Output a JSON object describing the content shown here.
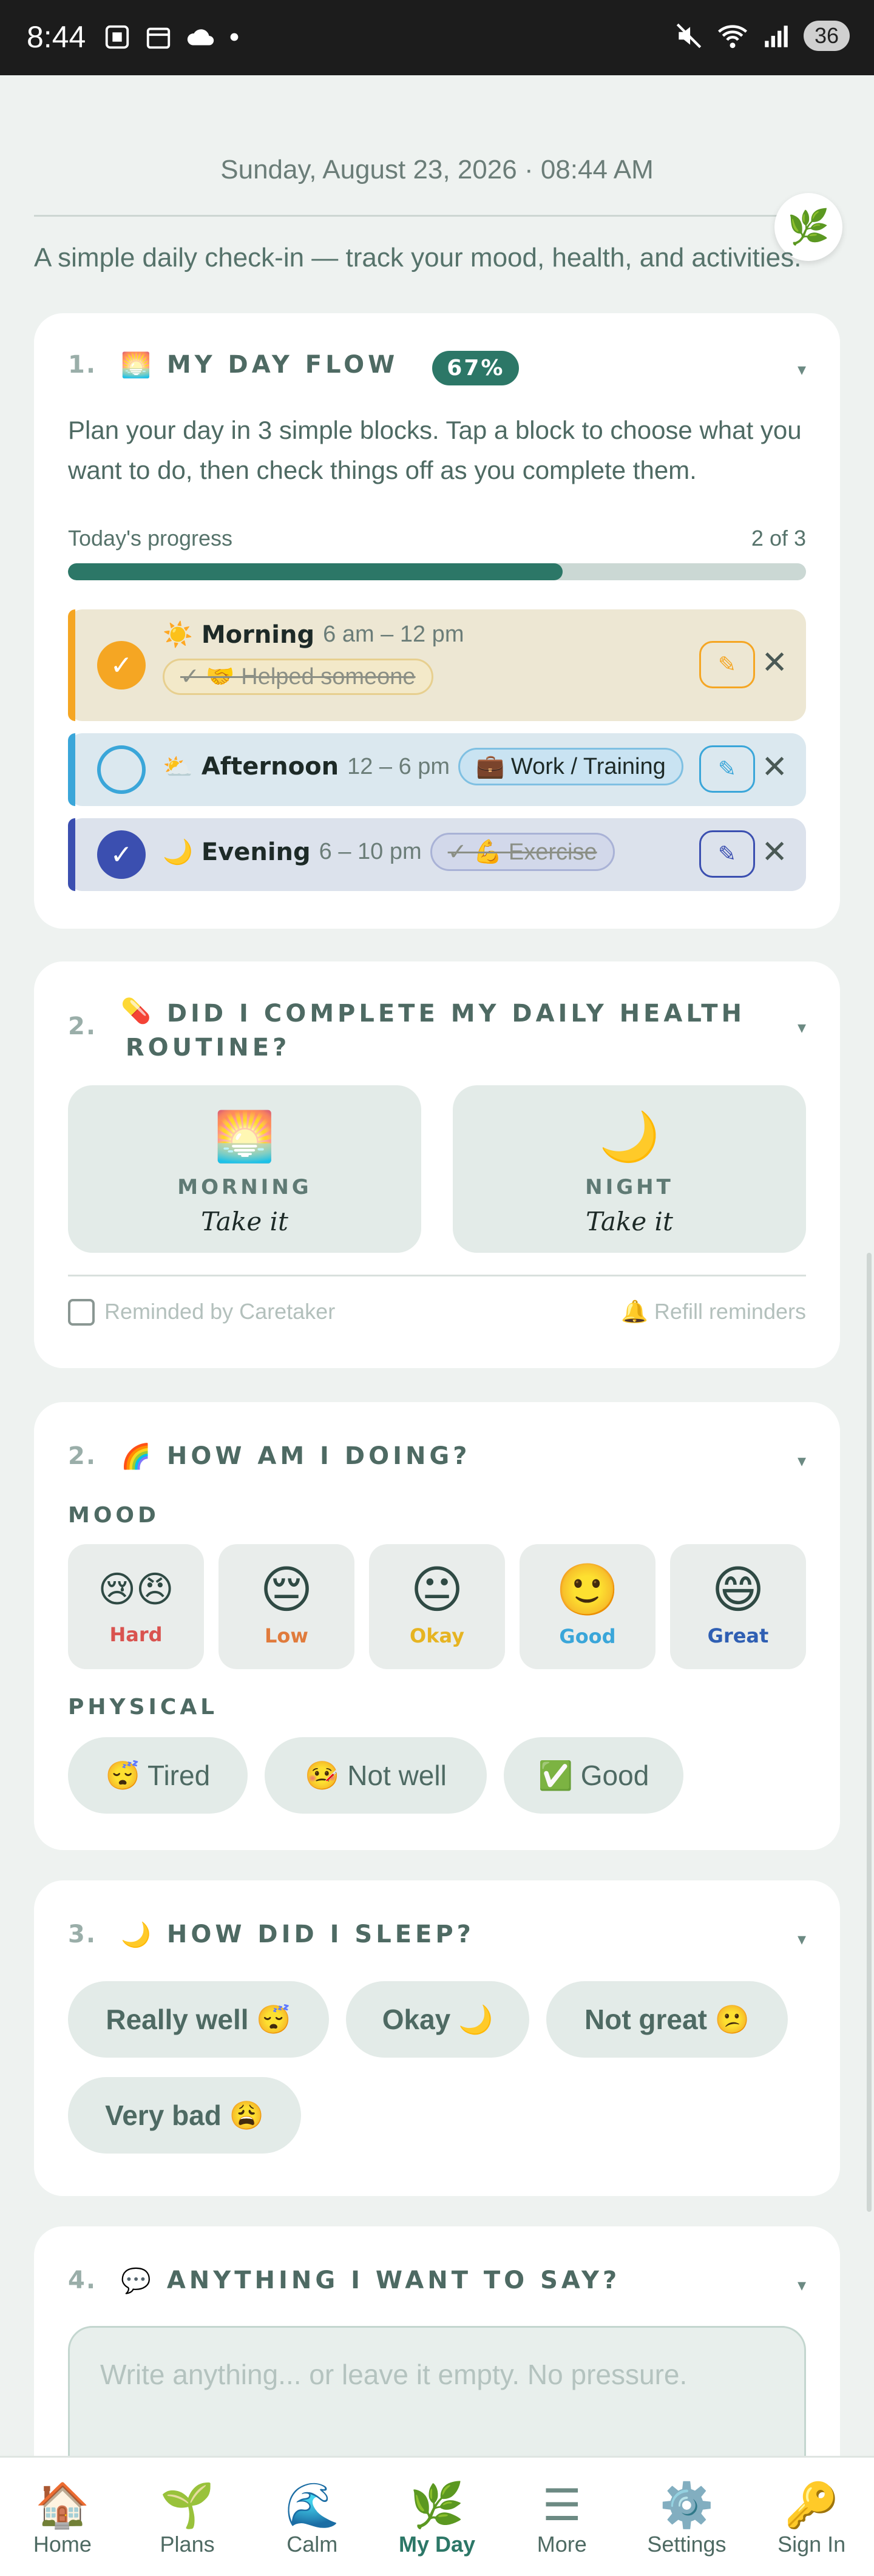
{
  "status_bar": {
    "time": "8:44",
    "battery": "36"
  },
  "date_line": "Sunday, August 23, 2026 · 08:44 AM",
  "intro": "A simple daily check-in — track your mood, health, and activities.",
  "day_flow": {
    "num": "1.",
    "icon": "🌅",
    "title": "MY DAY FLOW",
    "percent": "67%",
    "progress_fraction": 0.67,
    "description": "Plan your day in 3 simple blocks. Tap a block to choose what you want to do, then check things off as you complete them.",
    "progress_label": "Today's progress",
    "progress_count": "2 of 3",
    "blocks": [
      {
        "emoji": "☀️",
        "name": "Morning",
        "hours": "6 am – 12 pm",
        "chip": "✓ 🤝 Helped someone",
        "edit": "✎",
        "close": "✕",
        "check": "✓"
      },
      {
        "emoji": "⛅",
        "name": "Afternoon",
        "hours": "12 – 6 pm",
        "chip": "💼 Work / Training",
        "edit": "✎",
        "close": "✕",
        "check": ""
      },
      {
        "emoji": "🌙",
        "name": "Evening",
        "hours": "6 – 10 pm",
        "chip": "✓ 💪 Exercise",
        "edit": "✎",
        "close": "✕",
        "check": "✓"
      }
    ]
  },
  "health": {
    "num": "2.",
    "icon": "💊",
    "title_line1": "DID I COMPLETE MY DAILY HEALTH",
    "title_line2": "ROUTINE?",
    "morning": {
      "emoji": "🌅",
      "label": "MORNING",
      "value": "Take it"
    },
    "night": {
      "emoji": "🌙",
      "label": "NIGHT",
      "value": "Take it"
    },
    "reminded": "Reminded by Caretaker",
    "refill": "🔔 Refill reminders"
  },
  "doing": {
    "num": "2.",
    "icon": "🌈",
    "title": "HOW AM I DOING?",
    "mood_label": "MOOD",
    "moods": [
      {
        "emoji": "😢😠",
        "label": "Hard",
        "color": "#d9534f"
      },
      {
        "emoji": "😔",
        "label": "Low",
        "color": "#e07b3c"
      },
      {
        "emoji": "😐",
        "label": "Okay",
        "color": "#e6b422"
      },
      {
        "emoji": "🙂",
        "label": "Good",
        "color": "#3aa6d9"
      },
      {
        "emoji": "😄",
        "label": "Great",
        "color": "#2f5fb3"
      }
    ],
    "physical_label": "PHYSICAL",
    "physical": [
      "😴 Tired",
      "🤒 Not well",
      "✅ Good"
    ]
  },
  "sleep": {
    "num": "3.",
    "icon": "🌙",
    "title": "HOW DID I SLEEP?",
    "options": [
      "Really well 😴",
      "Okay 🌙",
      "Not great 😕",
      "Very bad 😩"
    ]
  },
  "say": {
    "num": "4.",
    "icon": "💬",
    "title": "ANYTHING I WANT TO SAY?",
    "placeholder": "Write anything... or leave it empty. No pressure."
  },
  "caret": "▾",
  "nav": [
    {
      "icon": "🏠",
      "label": "Home"
    },
    {
      "icon": "🌱",
      "label": "Plans"
    },
    {
      "icon": "🌊",
      "label": "Calm"
    },
    {
      "icon": "🌿",
      "label": "My Day"
    },
    {
      "icon": "☰",
      "label": "More"
    },
    {
      "icon": "⚙️",
      "label": "Settings"
    },
    {
      "icon": "🔑",
      "label": "Sign In"
    }
  ],
  "leaf_button_icon": "🌿"
}
